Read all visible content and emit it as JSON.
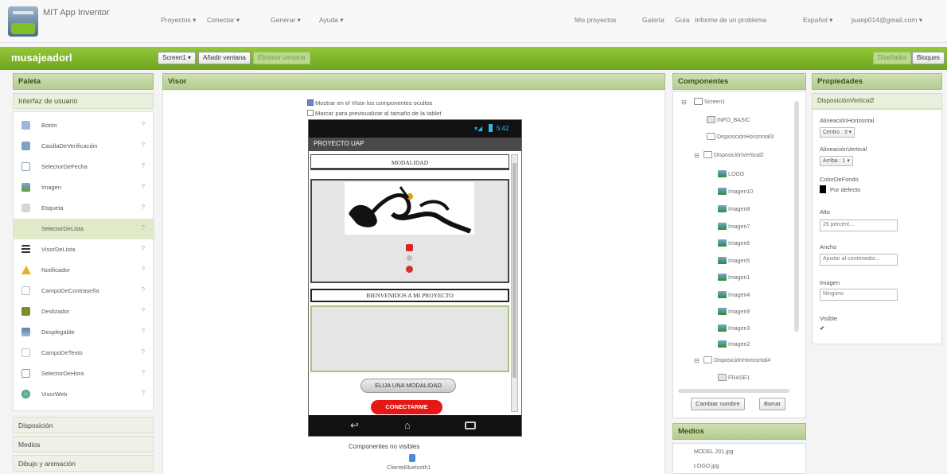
{
  "app": {
    "title": "MIT App Inventor"
  },
  "topmenu": {
    "left": [
      "Proyectos ▾",
      "Conectar ▾",
      "Generar ▾",
      "Ayuda ▾"
    ],
    "right": [
      "Mis proyectos",
      "Galería",
      "Guía",
      "Informe de un problema",
      "Español ▾",
      "juanp014@gmail.com ▾"
    ]
  },
  "project": {
    "name": "musajeadorl",
    "screen_select": "Screen1 ▾",
    "add_screen": "Añadir ventana",
    "remove_screen": "Eliminar ventana",
    "designer": "Diseñador",
    "blocks": "Bloques"
  },
  "palette": {
    "header": "Paleta",
    "subheader": "Interfaz de usuario",
    "items": [
      {
        "label": "Botón",
        "icon": "button-icon",
        "color": "#9fb7d6"
      },
      {
        "label": "CasillaDeVerificación",
        "icon": "checkbox-icon",
        "color": "#7fa0c9"
      },
      {
        "label": "SelectorDeFecha",
        "icon": "calendar-icon",
        "color": "#8aa4c0"
      },
      {
        "label": "Imagen",
        "icon": "image-icon",
        "color": "#7aa24a"
      },
      {
        "label": "Etiqueta",
        "icon": "label-icon",
        "color": "#b5b5b5"
      },
      {
        "label": "SelectorDeLista",
        "icon": "listpicker-icon",
        "color": "#dfeac9"
      },
      {
        "label": "VisorDeLista",
        "icon": "listview-icon",
        "color": "#333333"
      },
      {
        "label": "Notificador",
        "icon": "warning-icon",
        "color": "#e8b21b"
      },
      {
        "label": "CampoDeContraseña",
        "icon": "password-icon",
        "color": "#c4c4c4"
      },
      {
        "label": "Deslizador",
        "icon": "slider-icon",
        "color": "#7b8e2c"
      },
      {
        "label": "Desplegable",
        "icon": "spinner-icon",
        "color": "#5f7fae"
      },
      {
        "label": "CampoDeTexto",
        "icon": "textbox-icon",
        "color": "#b8c0cc"
      },
      {
        "label": "SelectorDeHora",
        "icon": "clock-icon",
        "color": "#8a9cb0"
      },
      {
        "label": "VisorWeb",
        "icon": "globe-icon",
        "color": "#4a8fd0"
      }
    ],
    "categories": [
      "Disposición",
      "Medios",
      "Dibujo y animación"
    ]
  },
  "viewer": {
    "header": "Visor",
    "check_hidden": "Mostrar en el Visor los componentes ocultos",
    "check_size": "Marcar para previsualizar al tamaño de la tablet",
    "time": "5:42",
    "app_title": "PROYECTO UAP",
    "modalidad": "MODALIDAD",
    "bienvenidos": "BIENVENIDOS A MI PROYECTO",
    "elija_btn": "ELIJA UNA MODALIDAD",
    "conectar_btn": "CONECTARME",
    "nonvisible_title": "Componentes no visibles",
    "nonvisible_item": "ClienteBluetooth1"
  },
  "components": {
    "header": "Componentes",
    "nodes": [
      {
        "label": "Screen1",
        "type": "screen"
      },
      {
        "label": "INFO_BASIC",
        "type": "button"
      },
      {
        "label": "DisposiciónHorizontal3",
        "type": "layout"
      },
      {
        "label": "DisposiciónVertical2",
        "type": "layout"
      },
      {
        "label": "LOGO",
        "type": "image"
      },
      {
        "label": "Imagen10",
        "type": "image"
      },
      {
        "label": "Imagen8",
        "type": "image"
      },
      {
        "label": "Imagen7",
        "type": "image"
      },
      {
        "label": "Imagen6",
        "type": "image"
      },
      {
        "label": "Imagen5",
        "type": "image"
      },
      {
        "label": "Imagen1",
        "type": "image"
      },
      {
        "label": "Imagen4",
        "type": "image"
      },
      {
        "label": "Imagen9",
        "type": "image"
      },
      {
        "label": "Imagen3",
        "type": "image"
      },
      {
        "label": "Imagen2",
        "type": "image"
      },
      {
        "label": "DisposiciónHorizontal4",
        "type": "layout"
      },
      {
        "label": "FRASE1",
        "type": "button"
      }
    ],
    "rename_btn": "Cambiar nombre",
    "delete_btn": "Borrar"
  },
  "media": {
    "header": "Medios",
    "files": [
      "MODEL 201.jpg",
      "LOGO.jpg"
    ]
  },
  "properties": {
    "header": "Propiedades",
    "component": "DisposiciónVertical2",
    "align_h_label": "AlineaciónHorizontal",
    "align_h_value": "Centro : 3 ▾",
    "align_v_label": "AlineaciónVertical",
    "align_v_value": "Arriba : 1 ▾",
    "bg_label": "ColorDeFondo",
    "bg_value": "Por defecto",
    "height_label": "Alto",
    "height_value": "25 percent...",
    "width_label": "Ancho",
    "width_value": "Ajustar al contenedor...",
    "image_label": "Imagen",
    "image_value": "Ninguno",
    "visible_label": "Visible",
    "visible_value": "✔"
  }
}
